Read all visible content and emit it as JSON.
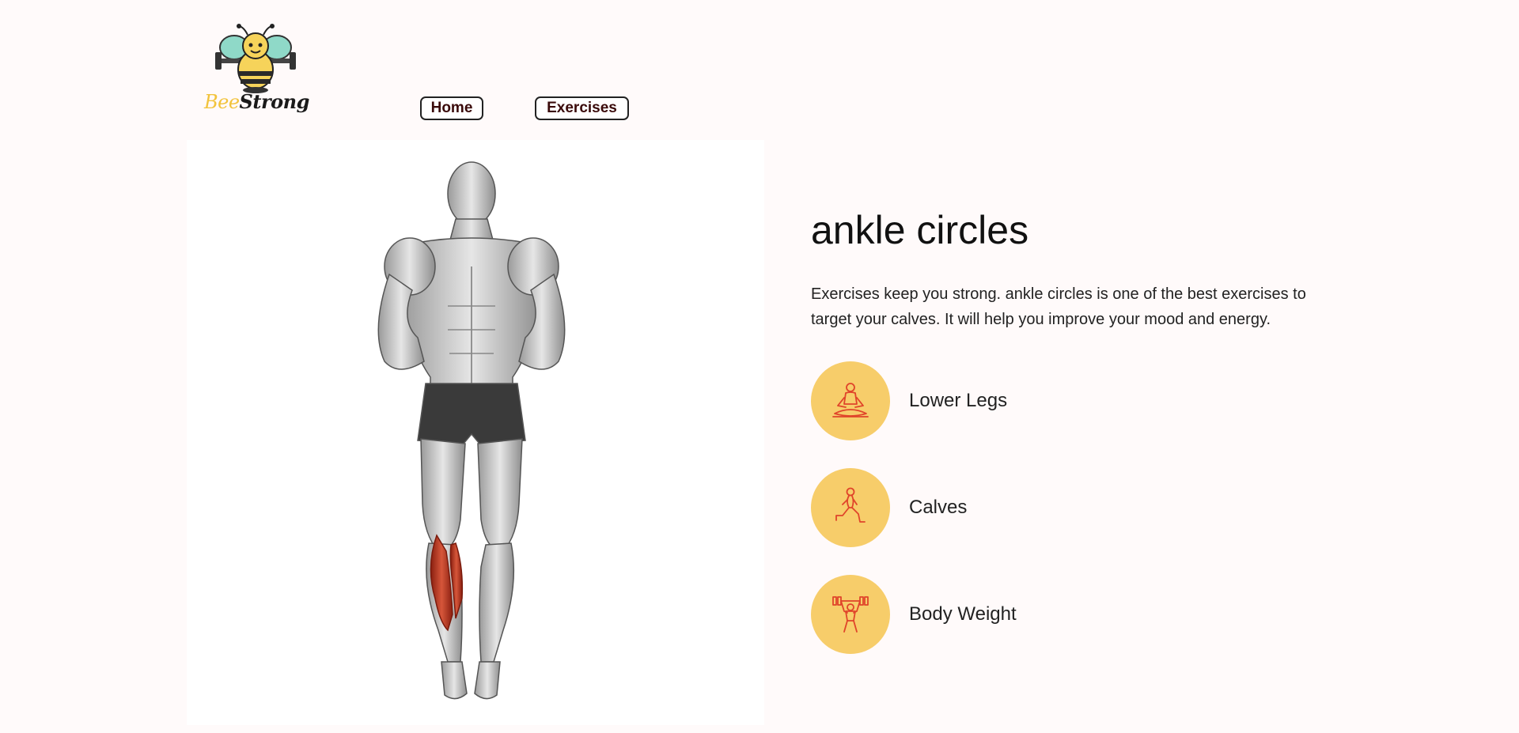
{
  "header": {
    "logo_word_bee": "Bee",
    "logo_word_strong": "Strong",
    "nav": {
      "home_label": "Home",
      "exercises_label": "Exercises"
    }
  },
  "exercise": {
    "name": "ankle circles",
    "description": "Exercises keep you strong. ankle circles is one of the best exercises to target your calves. It will help you improve your mood and energy.",
    "tags": [
      {
        "label": "Lower Legs",
        "icon": "yoga-pose-icon"
      },
      {
        "label": "Calves",
        "icon": "lunge-pose-icon"
      },
      {
        "label": "Body Weight",
        "icon": "dumbbell-lift-icon"
      }
    ],
    "image_icon": "muscle-anatomy-illustration"
  },
  "colors": {
    "background": "#fffafa",
    "tag_circle": "#f7cd6a",
    "icon_stroke": "#e0442a",
    "highlight_muscle": "#c0391f",
    "logo_yellow": "#f2c33c"
  }
}
